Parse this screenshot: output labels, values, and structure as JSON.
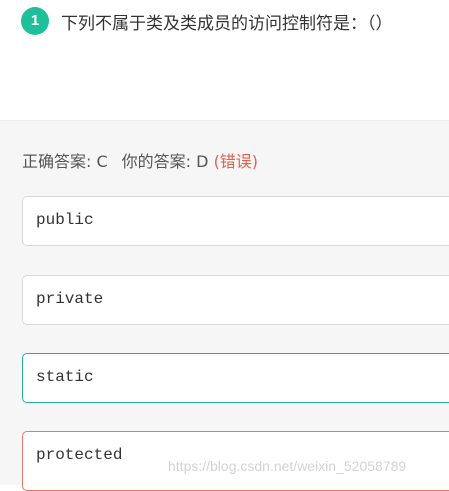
{
  "question": {
    "number": "1",
    "text": "下列不属于类及类成员的访问控制符是：（）"
  },
  "result": {
    "correct_label": "正确答案: C",
    "your_label": "你的答案: D",
    "status": "(错误)"
  },
  "options": [
    {
      "text": "public"
    },
    {
      "text": "private"
    },
    {
      "text": "static"
    },
    {
      "text": "protected"
    }
  ],
  "watermark": "https://blog.csdn.net/weixin_52058789",
  "colors": {
    "badge": "#1fbf9b",
    "correct_border": "#2aa9a9",
    "wrong_border": "#e8766a",
    "error_text": "#e8604c"
  }
}
